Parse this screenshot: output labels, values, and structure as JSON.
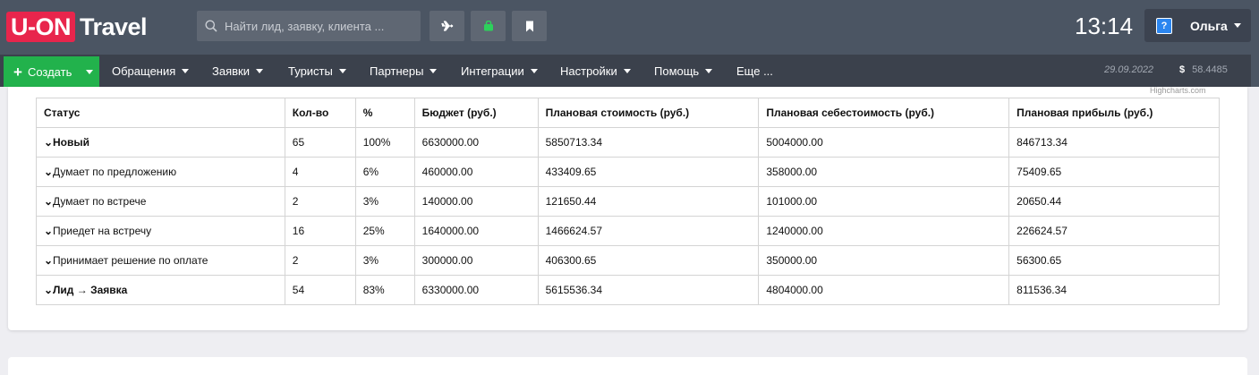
{
  "header": {
    "logo_box": "U-ON",
    "logo_text": "Travel",
    "search_placeholder": "Найти лид, заявку, клиента ...",
    "buttons": [
      "plane-icon",
      "bag-icon",
      "bookmark-icon"
    ],
    "clock": "13:14",
    "user_name": "Ольга"
  },
  "nav": {
    "create_label": "Создать",
    "items": [
      "Обращения",
      "Заявки",
      "Туристы",
      "Партнеры",
      "Интеграции",
      "Настройки",
      "Помощь",
      "Еще ..."
    ],
    "date": "29.09.2022",
    "rate_symbol": "$",
    "rate_value": "58.4485"
  },
  "credits": "Highcharts.com",
  "colors": {
    "topbar": "#4b5563",
    "navbar": "#3b414c",
    "create": "#22b24c",
    "logo": "#e8254c"
  },
  "table": {
    "headers": [
      "Статус",
      "Кол-во",
      "%",
      "Бюджет (руб.)",
      "Плановая стоимость (руб.)",
      "Плановая себестоимость (руб.)",
      "Плановая прибыль (руб.)"
    ],
    "rows": [
      {
        "bold": true,
        "cells": [
          "Новый",
          "65",
          "100%",
          "6630000.00",
          "5850713.34",
          "5004000.00",
          "846713.34"
        ]
      },
      {
        "bold": false,
        "cells": [
          "Думает по предложению",
          "4",
          "6%",
          "460000.00",
          "433409.65",
          "358000.00",
          "75409.65"
        ]
      },
      {
        "bold": false,
        "cells": [
          "Думает по встрече",
          "2",
          "3%",
          "140000.00",
          "121650.44",
          "101000.00",
          "20650.44"
        ]
      },
      {
        "bold": false,
        "cells": [
          "Приедет на встречу",
          "16",
          "25%",
          "1640000.00",
          "1466624.57",
          "1240000.00",
          "226624.57"
        ]
      },
      {
        "bold": false,
        "cells": [
          "Принимает решение по оплате",
          "2",
          "3%",
          "300000.00",
          "406300.65",
          "350000.00",
          "56300.65"
        ]
      },
      {
        "bold": true,
        "cells": [
          "Лид → Заявка",
          "54",
          "83%",
          "6330000.00",
          "5615536.34",
          "4804000.00",
          "811536.34"
        ]
      }
    ]
  }
}
